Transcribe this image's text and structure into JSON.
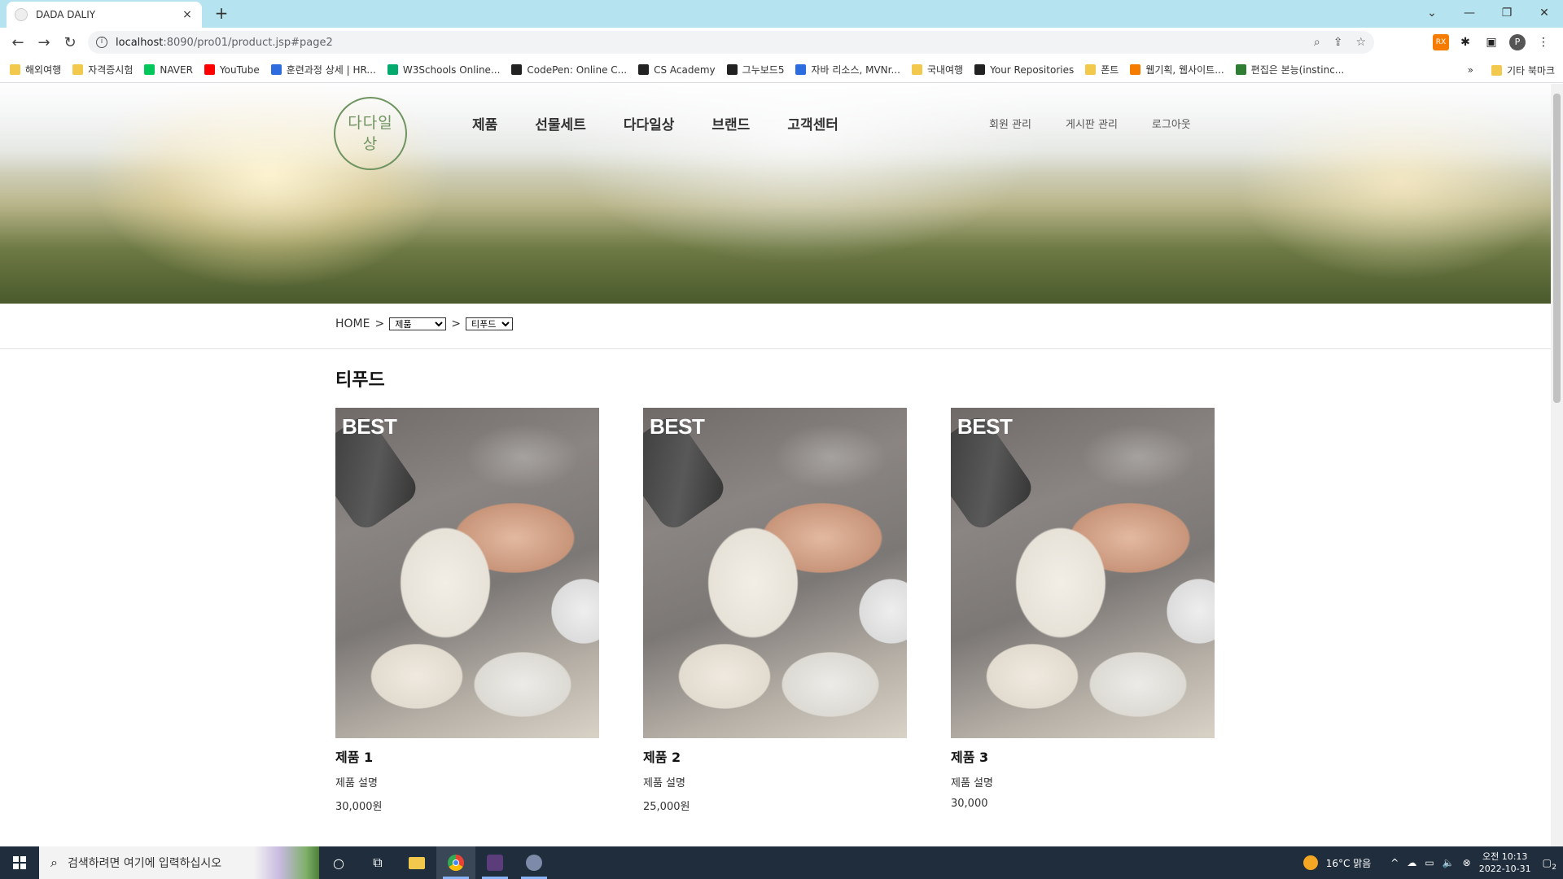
{
  "browser": {
    "tab_title": "DADA DALIY",
    "tab_close": "×",
    "new_tab": "+",
    "url_host": "localhost",
    "url_path": ":8090/pro01/product.jsp#page2",
    "profile_initial": "P",
    "window_controls": [
      "⌄",
      "—",
      "❐",
      "✕"
    ]
  },
  "bookmarks": [
    {
      "label": "해외여행",
      "icon_color": "#f2c94c"
    },
    {
      "label": "자격증시험",
      "icon_color": "#f2c94c"
    },
    {
      "label": "NAVER",
      "icon_color": "#03c75a"
    },
    {
      "label": "YouTube",
      "icon_color": "#ff0000"
    },
    {
      "label": "훈련과정 상세 | HR...",
      "icon_color": "#2d6cdf"
    },
    {
      "label": "W3Schools Online...",
      "icon_color": "#04aa6d"
    },
    {
      "label": "CodePen: Online C...",
      "icon_color": "#222222"
    },
    {
      "label": "CS Academy",
      "icon_color": "#222222"
    },
    {
      "label": "그누보드5",
      "icon_color": "#222222"
    },
    {
      "label": "자바 리소스, MVNr...",
      "icon_color": "#2d6cdf"
    },
    {
      "label": "국내여행",
      "icon_color": "#f2c94c"
    },
    {
      "label": "Your Repositories",
      "icon_color": "#222222"
    },
    {
      "label": "폰트",
      "icon_color": "#f2c94c"
    },
    {
      "label": "웹기획, 웹사이트...",
      "icon_color": "#f57c00"
    },
    {
      "label": "편집은 본능(instinc...",
      "icon_color": "#2e7d32"
    }
  ],
  "bookmarks_more": "»",
  "bookmarks_other": "기타 북마크",
  "site": {
    "logo_text": "다다일상",
    "main_nav": [
      "제품",
      "선물세트",
      "다다일상",
      "브랜드",
      "고객센터"
    ],
    "sub_nav": [
      "회원 관리",
      "게시판 관리",
      "로그아웃"
    ]
  },
  "breadcrumb": {
    "home": "HOME",
    "sep": ">",
    "category_selected": "제품",
    "subcategory_selected": "티푸드"
  },
  "section_title": "티푸드",
  "products": [
    {
      "badge": "BEST",
      "name": "제품 1",
      "desc": "제품 설명",
      "price": "30,000원"
    },
    {
      "badge": "BEST",
      "name": "제품 2",
      "desc": "제품 설명",
      "price": "25,000원"
    },
    {
      "badge": "BEST",
      "name": "제품 3",
      "desc": "제품 설명",
      "price": "30,000"
    }
  ],
  "taskbar": {
    "search_placeholder": "검색하려면 여기에 입력하십시오",
    "weather": "16°C 맑음",
    "clock_time": "오전 10:13",
    "clock_date": "2022-10-31",
    "notification_count": "2"
  }
}
